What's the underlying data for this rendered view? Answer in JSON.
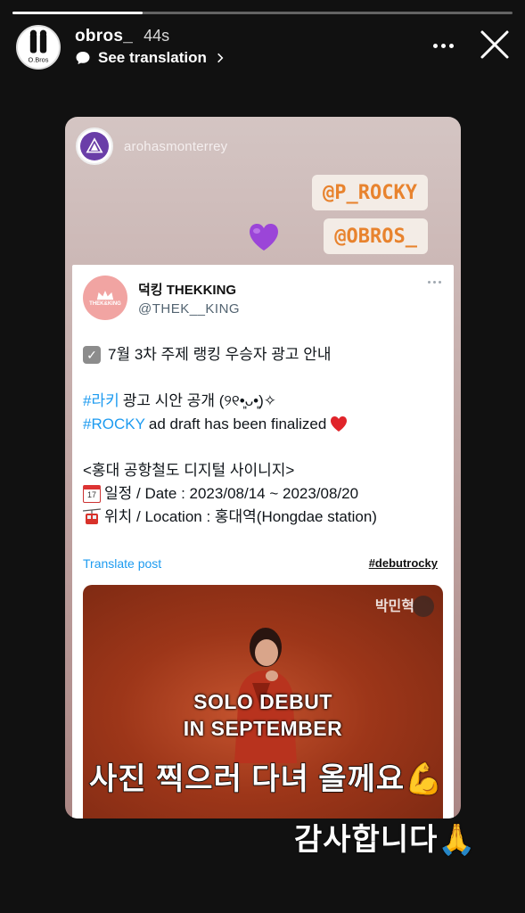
{
  "story": {
    "progress": 0.26,
    "username": "obros_",
    "timestamp": "44s",
    "see_translation": "See translation",
    "avatar_text": "O.Bros"
  },
  "shared_post": {
    "username": "arohasmonterrey",
    "avatar_text": "Aroha Monterrey",
    "mentions": [
      "@P_ROCKY",
      "@OBROS_"
    ]
  },
  "tweet": {
    "display_name": "덕킹 THEKKING",
    "handle": "@THEK__KING",
    "avatar_text": "THEK&KING",
    "line1": "7월 3차 주제 랭킹 우승자 광고 안내",
    "line2_hashtag": "#라키",
    "line2_rest": "광고 시안 공개 (୨୧•͈ᴗ•͈)✧",
    "line3_hashtag": "#ROCKY",
    "line3_rest": "ad draft has been finalized",
    "line4": "<홍대 공항철도 디지털 사이니지>",
    "line5": "일정 / Date : 2023/08/14 ~ 2023/08/20",
    "line6": "위치 / Location : 홍대역(Hongdae station)",
    "translate_post": "Translate post",
    "hashtag_link": "#debutrocky",
    "calendar_day": "17"
  },
  "video": {
    "watermark": "박민혁",
    "title_line1": "SOLO DEBUT",
    "title_line2": "IN SEPTEMBER"
  },
  "overlay": {
    "line1": "사진 찍으러 다녀 올께요",
    "line2": "감사합니다"
  }
}
